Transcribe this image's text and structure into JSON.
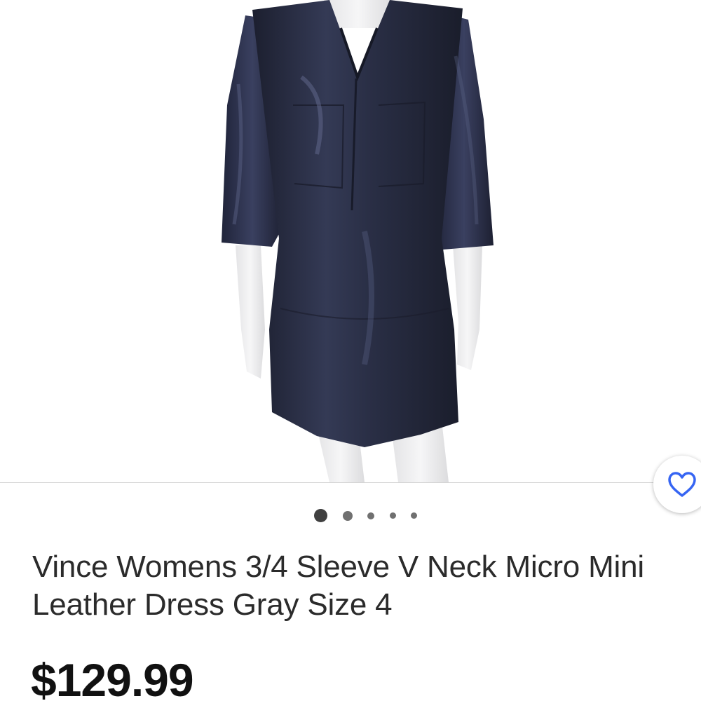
{
  "gallery": {
    "image_alt": "Vince Womens 3/4 Sleeve V Neck Micro Mini Leather Dress Gray Size 4",
    "image_count": 5,
    "active_index": 0
  },
  "favorite": {
    "icon": "heart-outline-icon",
    "color": "#3665f3"
  },
  "listing": {
    "title": "Vince Womens 3/4 Sleeve V Neck Micro Mini Leather Dress Gray Size 4",
    "price": "$129.99"
  },
  "colors": {
    "banner": "#e0263a",
    "dress": "#262a3e"
  }
}
